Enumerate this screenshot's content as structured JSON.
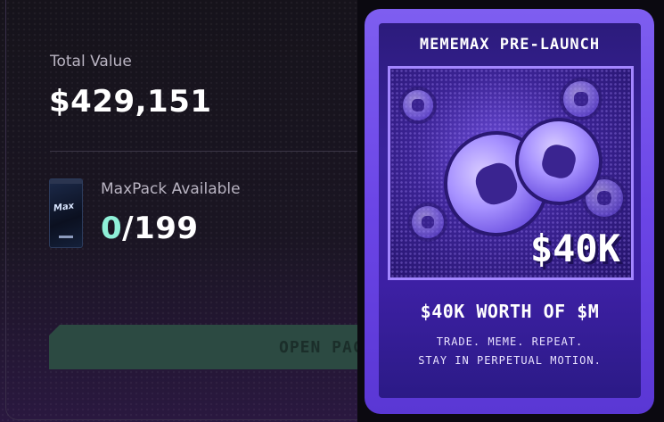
{
  "portfolio": {
    "total_value_label": "Total Value",
    "total_value": "$429,151",
    "pack_label": "MaxPack Available",
    "pack_count_available": "0",
    "pack_count_total": "/199",
    "pack_thumb_logo": "Max",
    "open_button_label": "OPEN PACK"
  },
  "promo": {
    "title": "MEMEMAX PRE-LAUNCH",
    "price": "$40K",
    "subtitle": "$40K WORTH OF $M",
    "tagline_1": "TRADE. MEME. REPEAT.",
    "tagline_2": "STAY IN PERPETUAL MOTION."
  },
  "colors": {
    "accent_teal": "#8ff0d8",
    "card_purple": "#6b45e6",
    "button_green": "#2c4a42"
  }
}
